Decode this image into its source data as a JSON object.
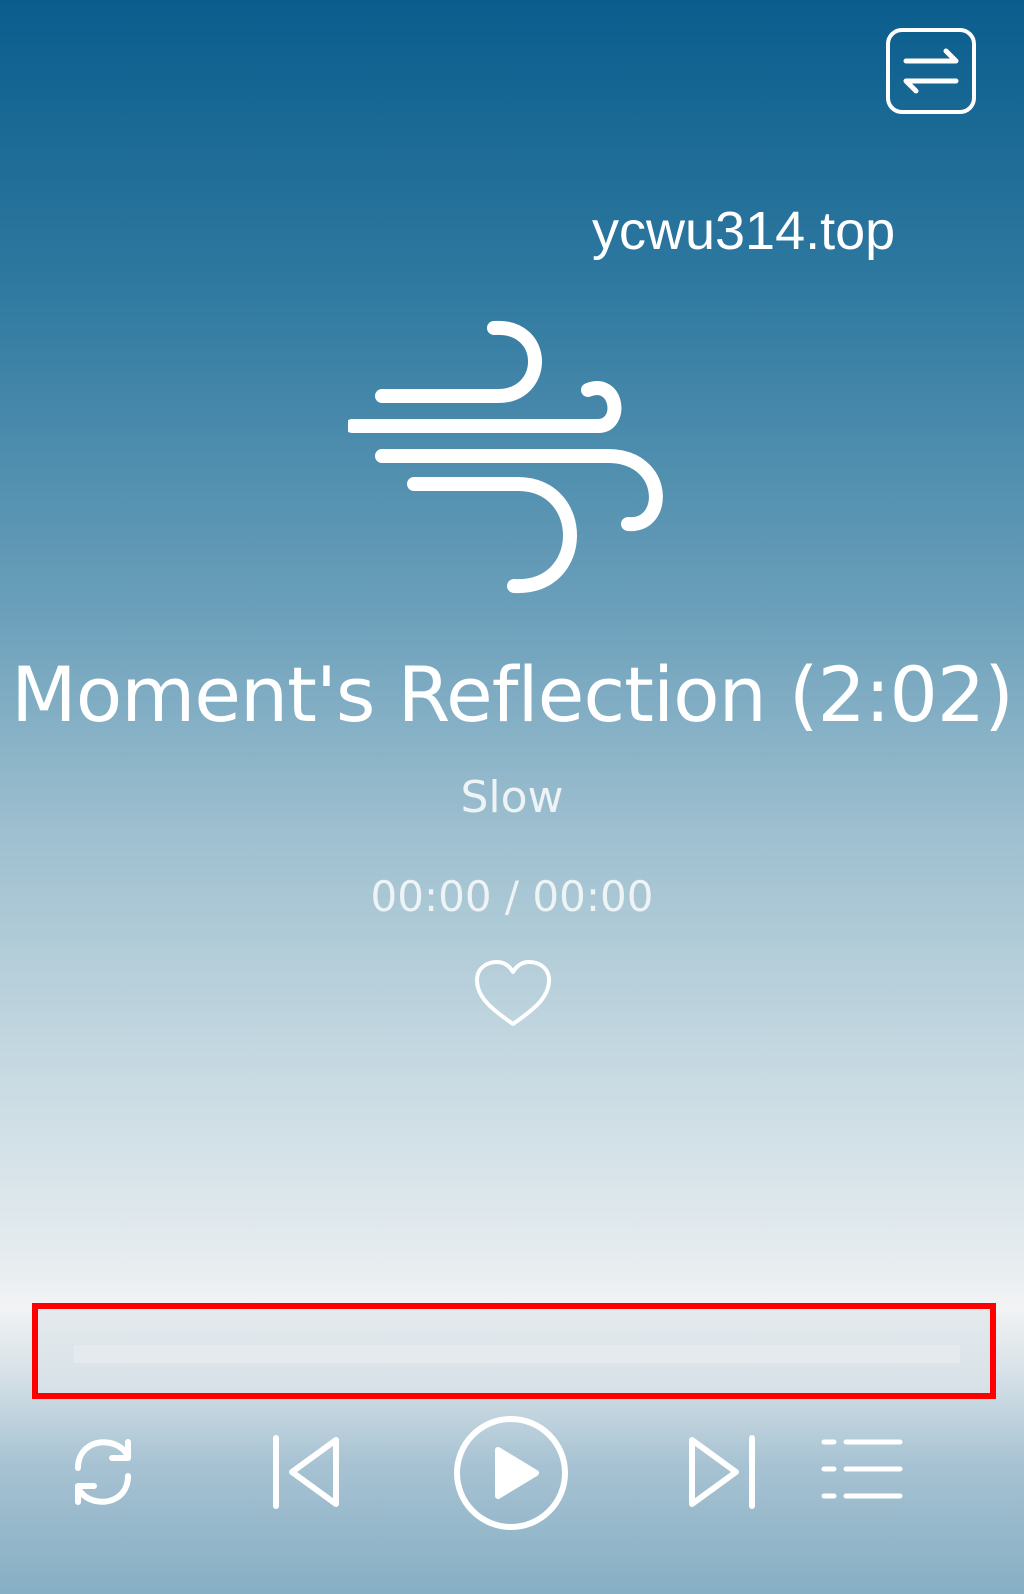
{
  "header": {
    "switch_icon": "switch-arrows-icon",
    "site_label": "ycwu314.top"
  },
  "cover": {
    "icon": "wind-icon"
  },
  "track": {
    "title": "Moment's Reflection (2:02)",
    "subtitle": "Slow",
    "time": "00:00 / 00:00",
    "like_icon": "heart-icon",
    "progress": 0
  },
  "controls": {
    "repeat_icon": "repeat-icon",
    "prev_icon": "skip-previous-icon",
    "play_icon": "play-icon",
    "next_icon": "skip-next-icon",
    "playlist_icon": "playlist-icon"
  },
  "colors": {
    "highlight": "#ff0000",
    "foreground": "#ffffff"
  }
}
